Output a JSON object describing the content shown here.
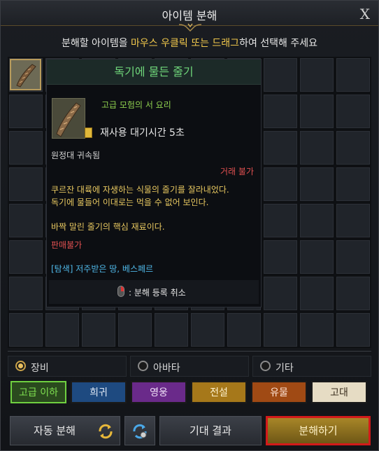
{
  "window": {
    "title": "아이템 분해",
    "close_label": "X"
  },
  "instruction": {
    "part1": "분해할 아이템을 ",
    "highlight1": "마우스 우클릭 또는 드래그",
    "part2": "하여 선택해 주세요"
  },
  "tooltip": {
    "item_name": "독기에 물든 줄기",
    "grade": "고급 모험의 서 요리",
    "cooldown": "재사용 대기시간 5초",
    "binding": "원정대 귀속됨",
    "trade": "거래 불가",
    "description_line1": "쿠르잔 대륙에 자생하는 식물의 줄기를 잘라내었다.",
    "description_line2": "독기에 물들어 이대로는 먹을 수 없어 보인다.",
    "core_text": "바짝 말린 줄기의 핵심 재료이다.",
    "not_sellable": "판매불가",
    "explore": "[탐색] 저주받은 땅, 베스페르",
    "hint": ": 분해 등록 취소"
  },
  "categories": [
    {
      "label": "장비",
      "selected": true
    },
    {
      "label": "아바타",
      "selected": false
    },
    {
      "label": "기타",
      "selected": false
    }
  ],
  "grades": [
    {
      "label": "고급 이하",
      "color": "#7fe050",
      "bg": "#2a4a1e",
      "border": "#6fd040"
    },
    {
      "label": "희귀",
      "color": "#dfe8f4",
      "bg": "#1e4a80",
      "border": "#1a1a1a"
    },
    {
      "label": "영웅",
      "color": "#f0e0f8",
      "bg": "#6a2a8a",
      "border": "#1a1a1a"
    },
    {
      "label": "전설",
      "color": "#fff3d0",
      "bg": "#a6781a",
      "border": "#1a1a1a"
    },
    {
      "label": "유물",
      "color": "#ffe6d8",
      "bg": "#a04a14",
      "border": "#1a1a1a"
    },
    {
      "label": "고대",
      "color": "#3a2e1e",
      "bg": "#e6dcc4",
      "border": "#1a1a1a"
    }
  ],
  "actions": {
    "auto": "자동 분해",
    "expect": "기대 결과",
    "disassemble": "분해하기"
  },
  "icons": [
    "close-icon",
    "ornament-icon",
    "item-stem-icon",
    "ticket-icon",
    "mouse-right-click-icon",
    "refresh-icon",
    "settings-refresh-icon"
  ]
}
